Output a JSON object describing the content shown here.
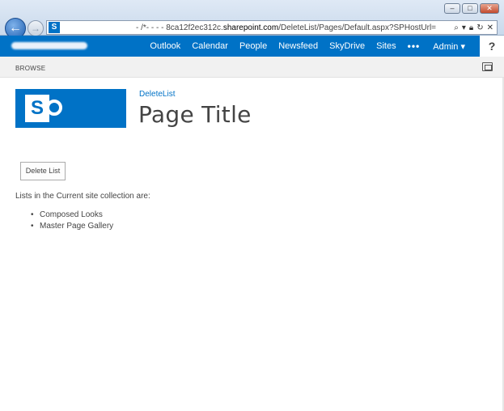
{
  "browser": {
    "url_prefix": "‑ /*‑ ‑ ‑ ‑ 8ca12f2ec312c.",
    "url_domain": "sharepoint.com",
    "url_path": "/DeleteList/Pages/Default.aspx?SPHostUrl=",
    "window_buttons": [
      "minimize",
      "maximize",
      "close"
    ]
  },
  "suitebar": {
    "links": [
      "Outlook",
      "Calendar",
      "People",
      "Newsfeed",
      "SkyDrive",
      "Sites"
    ],
    "more": "•••",
    "user": "Admin ▾",
    "help": "?"
  },
  "ribbon": {
    "tab": "BROWSE"
  },
  "header": {
    "breadcrumb": "DeleteList",
    "title": "Page Title"
  },
  "content": {
    "button_label": "Delete List",
    "lists_label": "Lists in the Current site collection are:",
    "lists": [
      "Composed Looks",
      "Master Page Gallery"
    ]
  },
  "colors": {
    "accent": "#0072c6",
    "text": "#444444"
  }
}
